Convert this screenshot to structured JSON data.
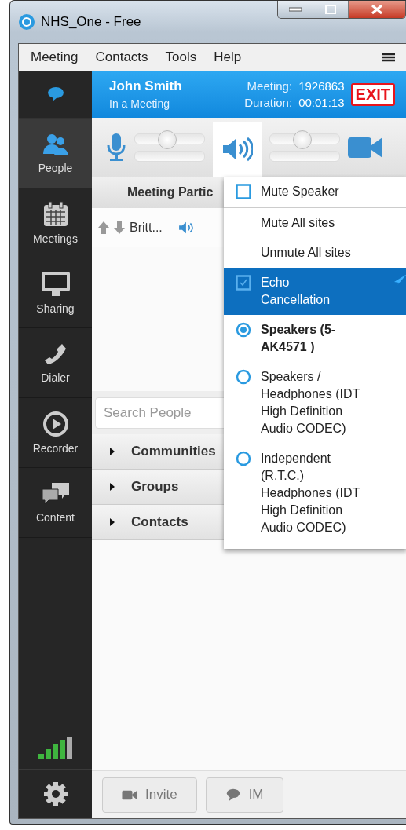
{
  "window": {
    "title": "NHS_One - Free"
  },
  "menu": [
    "Meeting",
    "Contacts",
    "Tools",
    "Help"
  ],
  "header": {
    "name": "John Smith",
    "status": "In a Meeting",
    "meeting_label": "Meeting:",
    "meeting_id": "1926863",
    "duration_label": "Duration:",
    "duration": "00:01:13",
    "exit": "EXIT"
  },
  "sidebar": {
    "items": [
      {
        "label": "People",
        "kind": "people",
        "selected": true
      },
      {
        "label": "Meetings",
        "kind": "calendar",
        "selected": false
      },
      {
        "label": "Sharing",
        "kind": "monitor",
        "selected": false
      },
      {
        "label": "Dialer",
        "kind": "phone",
        "selected": false
      },
      {
        "label": "Recorder",
        "kind": "record",
        "selected": false
      },
      {
        "label": "Content",
        "kind": "chat",
        "selected": false
      }
    ]
  },
  "toolbar": {
    "mic_slider": {
      "level": 0.45
    },
    "speaker_slider": {
      "level": 0.45
    },
    "speaker_open": true
  },
  "participants": {
    "heading": "Meeting Partic",
    "rows": [
      {
        "name": "Britt..."
      }
    ]
  },
  "search": {
    "placeholder": "Search People"
  },
  "groups": [
    {
      "label": "Communities",
      "expanded": false
    },
    {
      "label": "Groups",
      "expanded": false
    },
    {
      "label": "Contacts",
      "expanded": false
    }
  ],
  "speaker_menu": [
    {
      "kind": "checkbox",
      "label": "Mute Speaker",
      "checked": false,
      "highlighted": false
    },
    {
      "kind": "action",
      "label": "Mute All sites",
      "highlighted": false
    },
    {
      "kind": "action",
      "label": "Unmute All sites",
      "highlighted": false
    },
    {
      "kind": "checkbox",
      "label": "Echo Cancellation",
      "checked": true,
      "highlighted": true
    },
    {
      "kind": "radio",
      "label": "Speakers (5-AK4571 )",
      "selected": true,
      "highlighted": false
    },
    {
      "kind": "radio",
      "label": "Speakers / Headphones (IDT High Definition Audio CODEC)",
      "selected": false,
      "highlighted": false
    },
    {
      "kind": "radio",
      "label": "Independent (R.T.C.) Headphones (IDT High Definition Audio CODEC)",
      "selected": false,
      "highlighted": false
    }
  ],
  "footer": {
    "buttons": [
      "Invite",
      "IM"
    ]
  }
}
